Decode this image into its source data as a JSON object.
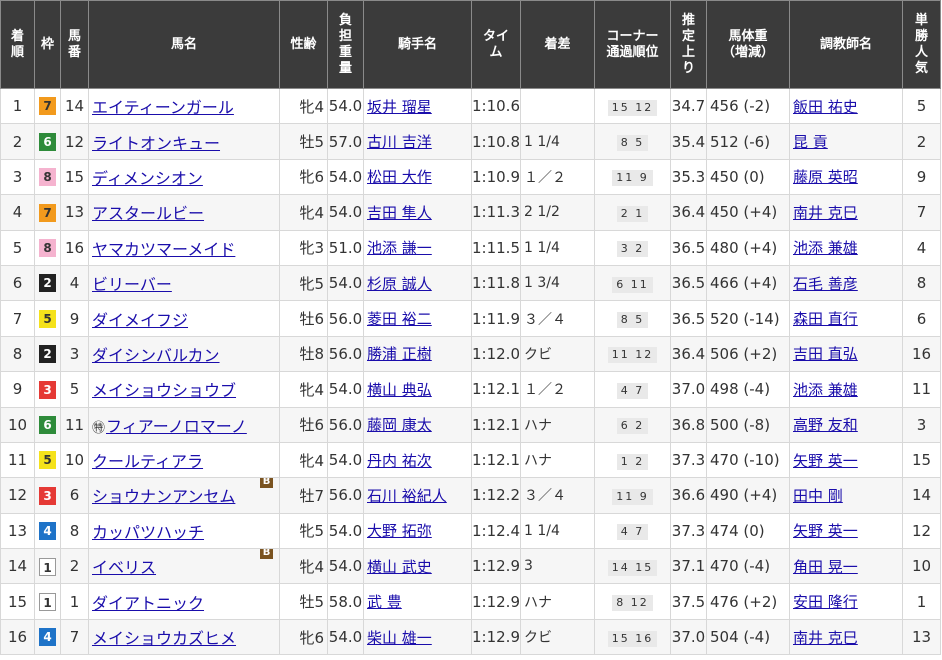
{
  "headers": [
    "着順",
    "枠",
    "馬番",
    "馬名",
    "性齢",
    "負担重量",
    "騎手名",
    "タイム",
    "着差",
    "コーナー通過順位",
    "推定上り",
    "馬体重（増減）",
    "調教師名",
    "単勝人気"
  ],
  "header_lines": {
    "chaku": [
      "着",
      "順"
    ],
    "waku": [
      "枠"
    ],
    "umaban": [
      "馬",
      "番"
    ],
    "name": [
      "馬名"
    ],
    "sexage": [
      "性齢"
    ],
    "weight": [
      "負",
      "担",
      "重",
      "量"
    ],
    "jockey": [
      "騎手名"
    ],
    "time": [
      "タイ",
      "ム"
    ],
    "margin": [
      "着差"
    ],
    "corner": [
      "コーナー",
      "通過順位"
    ],
    "agari": [
      "推",
      "定",
      "上",
      "り"
    ],
    "body": [
      "馬体重",
      "（増減）"
    ],
    "trainer": [
      "調教師名"
    ],
    "pop": [
      "単",
      "勝",
      "人",
      "気"
    ]
  },
  "rows": [
    {
      "rank": "1",
      "waku": "7",
      "num": "14",
      "mark": "",
      "name": "エイティーンガール",
      "blinker": "",
      "sexage": "牝4",
      "weight": "54.0",
      "jockey": "坂井 瑠星",
      "time": "1:10.6",
      "margin": "",
      "corner": "15 12",
      "agari": "34.7",
      "body": "456 (-2)",
      "trainer": "飯田 祐史",
      "pop": "5"
    },
    {
      "rank": "2",
      "waku": "6",
      "num": "12",
      "mark": "",
      "name": "ライトオンキュー",
      "blinker": "",
      "sexage": "牡5",
      "weight": "57.0",
      "jockey": "古川 吉洋",
      "time": "1:10.8",
      "margin": "1 1/4",
      "corner": "8 5",
      "agari": "35.4",
      "body": "512 (-6)",
      "trainer": "昆 貢",
      "pop": "2"
    },
    {
      "rank": "3",
      "waku": "8",
      "num": "15",
      "mark": "",
      "name": "ディメンシオン",
      "blinker": "",
      "sexage": "牝6",
      "weight": "54.0",
      "jockey": "松田 大作",
      "time": "1:10.9",
      "margin": "１／２",
      "corner": "11 9",
      "agari": "35.3",
      "body": "450 (0)",
      "trainer": "藤原 英昭",
      "pop": "9"
    },
    {
      "rank": "4",
      "waku": "7",
      "num": "13",
      "mark": "",
      "name": "アスタールビー",
      "blinker": "",
      "sexage": "牝4",
      "weight": "54.0",
      "jockey": "吉田 隼人",
      "time": "1:11.3",
      "margin": "2 1/2",
      "corner": "2 1",
      "agari": "36.4",
      "body": "450 (+4)",
      "trainer": "南井 克巳",
      "pop": "7"
    },
    {
      "rank": "5",
      "waku": "8",
      "num": "16",
      "mark": "",
      "name": "ヤマカツマーメイド",
      "blinker": "",
      "sexage": "牝3",
      "weight": "51.0",
      "jockey": "池添 謙一",
      "time": "1:11.5",
      "margin": "1 1/4",
      "corner": "3 2",
      "agari": "36.5",
      "body": "480 (+4)",
      "trainer": "池添 兼雄",
      "pop": "4"
    },
    {
      "rank": "6",
      "waku": "2",
      "num": "4",
      "mark": "",
      "name": "ビリーバー",
      "blinker": "",
      "sexage": "牝5",
      "weight": "54.0",
      "jockey": "杉原 誠人",
      "time": "1:11.8",
      "margin": "1 3/4",
      "corner": "6 11",
      "agari": "36.5",
      "body": "466 (+4)",
      "trainer": "石毛 善彦",
      "pop": "8"
    },
    {
      "rank": "7",
      "waku": "5",
      "num": "9",
      "mark": "",
      "name": "ダイメイフジ",
      "blinker": "",
      "sexage": "牡6",
      "weight": "56.0",
      "jockey": "菱田 裕二",
      "time": "1:11.9",
      "margin": "３／４",
      "corner": "8 5",
      "agari": "36.5",
      "body": "520 (-14)",
      "trainer": "森田 直行",
      "pop": "6"
    },
    {
      "rank": "8",
      "waku": "2",
      "num": "3",
      "mark": "",
      "name": "ダイシンバルカン",
      "blinker": "",
      "sexage": "牡8",
      "weight": "56.0",
      "jockey": "勝浦 正樹",
      "time": "1:12.0",
      "margin": "クビ",
      "corner": "11 12",
      "agari": "36.4",
      "body": "506 (+2)",
      "trainer": "吉田 直弘",
      "pop": "16"
    },
    {
      "rank": "9",
      "waku": "3",
      "num": "5",
      "mark": "",
      "name": "メイショウショウブ",
      "blinker": "",
      "sexage": "牝4",
      "weight": "54.0",
      "jockey": "横山 典弘",
      "time": "1:12.1",
      "margin": "１／２",
      "corner": "4 7",
      "agari": "37.0",
      "body": "498 (-4)",
      "trainer": "池添 兼雄",
      "pop": "11"
    },
    {
      "rank": "10",
      "waku": "6",
      "num": "11",
      "mark": "㊕",
      "name": "フィアーノロマーノ",
      "blinker": "",
      "sexage": "牡6",
      "weight": "56.0",
      "jockey": "藤岡 康太",
      "time": "1:12.1",
      "margin": "ハナ",
      "corner": "6 2",
      "agari": "36.8",
      "body": "500 (-8)",
      "trainer": "高野 友和",
      "pop": "3"
    },
    {
      "rank": "11",
      "waku": "5",
      "num": "10",
      "mark": "",
      "name": "クールティアラ",
      "blinker": "",
      "sexage": "牝4",
      "weight": "54.0",
      "jockey": "丹内 祐次",
      "time": "1:12.1",
      "margin": "ハナ",
      "corner": "1 2",
      "agari": "37.3",
      "body": "470 (-10)",
      "trainer": "矢野 英一",
      "pop": "15"
    },
    {
      "rank": "12",
      "waku": "3",
      "num": "6",
      "mark": "",
      "name": "ショウナンアンセム",
      "blinker": "B",
      "sexage": "牡7",
      "weight": "56.0",
      "jockey": "石川 裕紀人",
      "time": "1:12.2",
      "margin": "３／４",
      "corner": "11 9",
      "agari": "36.6",
      "body": "490 (+4)",
      "trainer": "田中 剛",
      "pop": "14"
    },
    {
      "rank": "13",
      "waku": "4",
      "num": "8",
      "mark": "",
      "name": "カッパツハッチ",
      "blinker": "",
      "sexage": "牝5",
      "weight": "54.0",
      "jockey": "大野 拓弥",
      "time": "1:12.4",
      "margin": "1 1/4",
      "corner": "4 7",
      "agari": "37.3",
      "body": "474 (0)",
      "trainer": "矢野 英一",
      "pop": "12"
    },
    {
      "rank": "14",
      "waku": "1",
      "num": "2",
      "mark": "",
      "name": "イベリス",
      "blinker": "B",
      "sexage": "牝4",
      "weight": "54.0",
      "jockey": "横山 武史",
      "time": "1:12.9",
      "margin": "3",
      "corner": "14 15",
      "agari": "37.1",
      "body": "470 (-4)",
      "trainer": "角田 晃一",
      "pop": "10"
    },
    {
      "rank": "15",
      "waku": "1",
      "num": "1",
      "mark": "",
      "name": "ダイアトニック",
      "blinker": "",
      "sexage": "牡5",
      "weight": "58.0",
      "jockey": "武 豊",
      "time": "1:12.9",
      "margin": "ハナ",
      "corner": "8 12",
      "agari": "37.5",
      "body": "476 (+2)",
      "trainer": "安田 隆行",
      "pop": "1"
    },
    {
      "rank": "16",
      "waku": "4",
      "num": "7",
      "mark": "",
      "name": "メイショウカズヒメ",
      "blinker": "",
      "sexage": "牝6",
      "weight": "54.0",
      "jockey": "柴山 雄一",
      "time": "1:12.9",
      "margin": "クビ",
      "corner": "15 16",
      "agari": "37.0",
      "body": "504 (-4)",
      "trainer": "南井 克巳",
      "pop": "13"
    }
  ]
}
